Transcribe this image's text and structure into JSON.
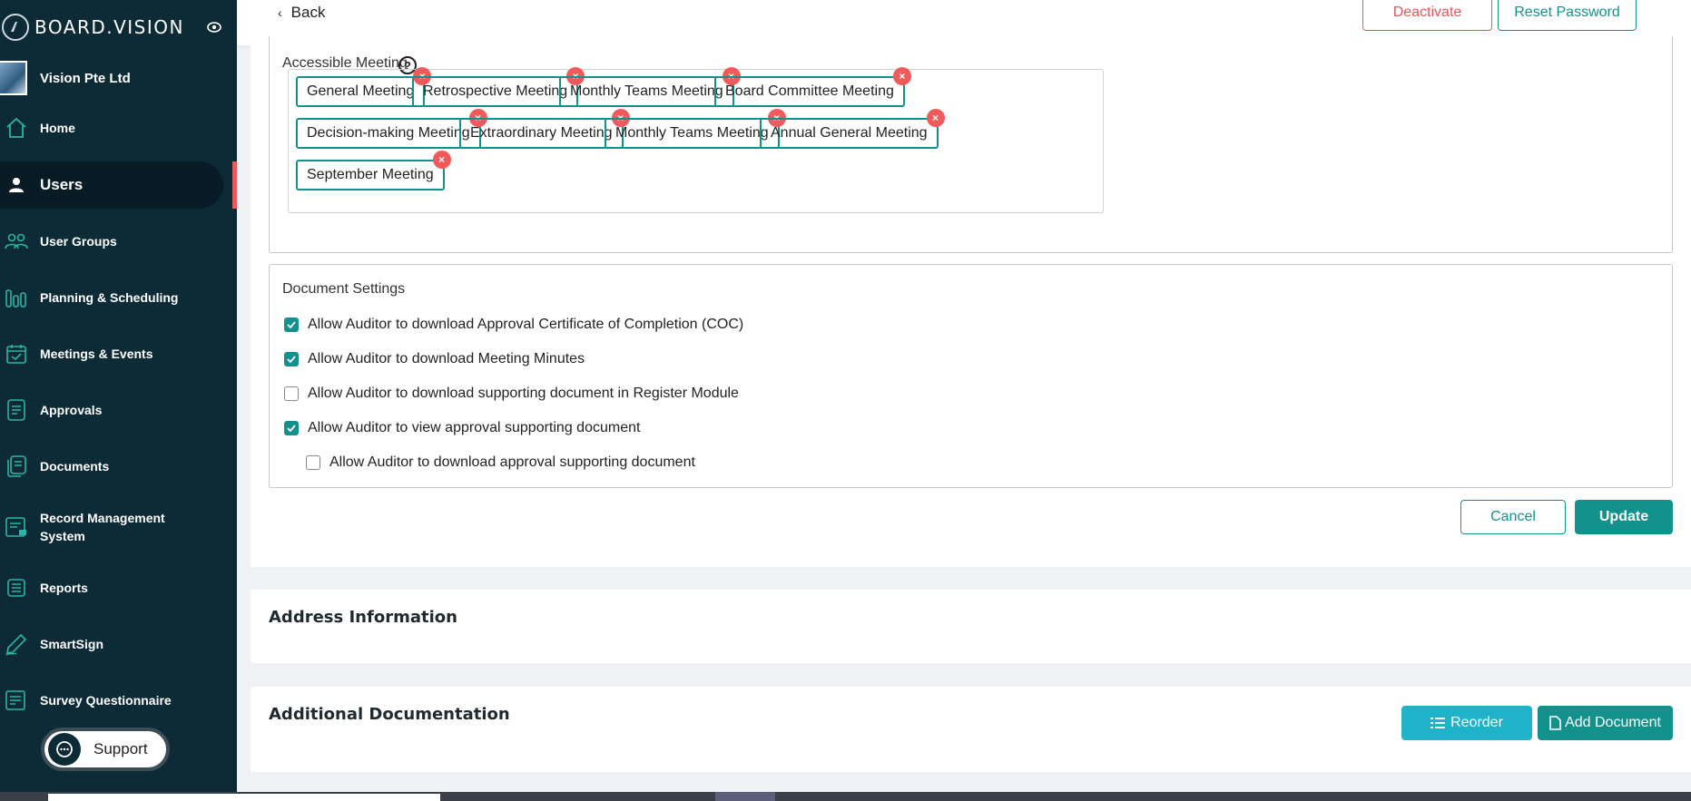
{
  "brand": {
    "name": "BOARD.VISION"
  },
  "org": {
    "name": "Vision Pte Ltd"
  },
  "sidebar": {
    "items": [
      {
        "label": "Home",
        "icon": "home-icon"
      },
      {
        "label": "Users",
        "icon": "user-icon"
      },
      {
        "label": "User Groups",
        "icon": "user-groups-icon"
      },
      {
        "label": "Planning & Scheduling",
        "icon": "chart-bars-icon"
      },
      {
        "label": "Meetings & Events",
        "icon": "calendar-check-icon"
      },
      {
        "label": "Approvals",
        "icon": "document-icon"
      },
      {
        "label": "Documents",
        "icon": "documents-icon"
      },
      {
        "label": "Record Management System",
        "icon": "record-icon"
      },
      {
        "label": "Reports",
        "icon": "list-icon"
      },
      {
        "label": "SmartSign",
        "icon": "pen-icon"
      },
      {
        "label": "Survey Questionnaire",
        "icon": "survey-icon"
      }
    ],
    "active": "Users",
    "support_label": "Support"
  },
  "topbar": {
    "back_label": "Back",
    "deactivate_label": "Deactivate",
    "reset_password_label": "Reset Password"
  },
  "accessible_meeting": {
    "title": "Accessible Meeting",
    "help": "?",
    "tags": [
      "General Meeting",
      "Retrospective Meeting",
      "Monthly Teams Meeting",
      "Board Committee Meeting",
      "Decision-making Meeting",
      "Extraordinary Meeting",
      "Monthly Teams Meeting",
      "Annual General Meeting",
      "September Meeting"
    ],
    "remove_glyph": "×"
  },
  "document_settings": {
    "title": "Document Settings",
    "options": [
      {
        "label": "Allow Auditor to download Approval Certificate of Completion (COC)",
        "checked": true
      },
      {
        "label": "Allow Auditor to download Meeting Minutes",
        "checked": true
      },
      {
        "label": "Allow Auditor to download supporting document in Register Module",
        "checked": false
      },
      {
        "label": "Allow Auditor to view approval supporting document",
        "checked": true
      },
      {
        "label": "Allow Auditor to download approval supporting document",
        "checked": false
      }
    ]
  },
  "actions": {
    "cancel_label": "Cancel",
    "update_label": "Update"
  },
  "address": {
    "title": "Address Information"
  },
  "additional_docs": {
    "title": "Additional Documentation",
    "reorder_label": "Reorder",
    "add_document_label": "Add Document"
  },
  "colors": {
    "teal": "#13918c",
    "sidebar": "#0d2b36",
    "danger": "#e5555a",
    "cyan": "#1fb3c9"
  }
}
